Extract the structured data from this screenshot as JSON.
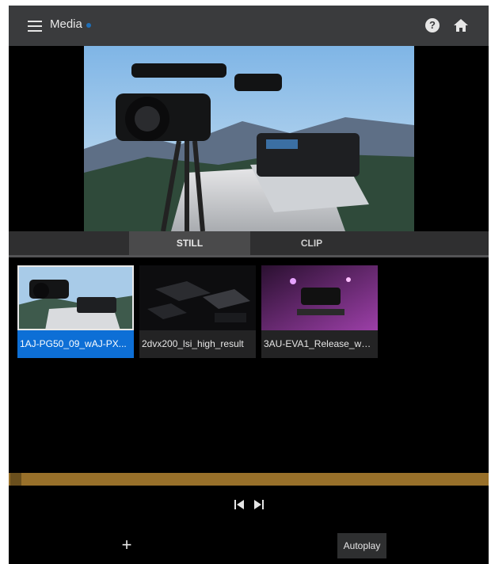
{
  "header": {
    "title": "Media",
    "icons": {
      "menu": "menu-icon",
      "help": "help-icon",
      "home": "home-icon"
    },
    "status_color": "#1f6fb8"
  },
  "preview": {
    "description_icon": "camcorder-preview"
  },
  "tabs": [
    {
      "label": "STILL",
      "active": true
    },
    {
      "label": "CLIP",
      "active": false
    }
  ],
  "thumbnails": [
    {
      "label": "1AJ-PG50_09_wAJ-PX...",
      "selected": true
    },
    {
      "label": "2dvx200_lsi_high_result",
      "selected": false
    },
    {
      "label": "3AU-EVA1_Release_wB...",
      "selected": false
    }
  ],
  "timeline": {
    "progress": 0.02,
    "color": "#98702a"
  },
  "controls": {
    "prev_icon": "skip-previous-icon",
    "next_icon": "skip-next-icon",
    "add_label": "+",
    "autoplay_label": "Autoplay"
  },
  "colors": {
    "accent": "#0d6fd6",
    "header_bg": "#3a3b3d"
  }
}
